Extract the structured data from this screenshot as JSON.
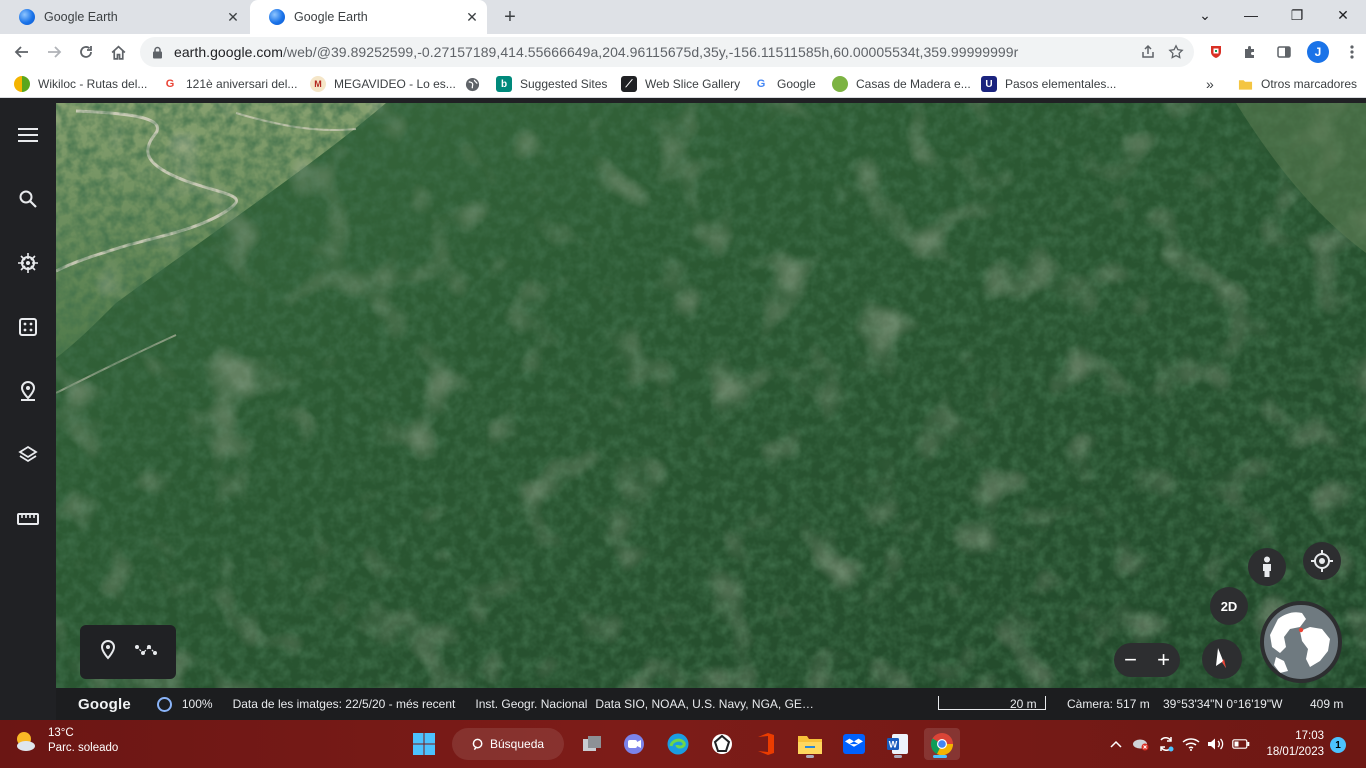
{
  "browser": {
    "tabs": [
      {
        "title": "Google Earth",
        "close": "✕"
      },
      {
        "title": "Google Earth",
        "close": "✕"
      }
    ],
    "new_tab": "+",
    "window_controls": {
      "minimize": "—",
      "maximize": "❐",
      "close": "✕",
      "tab_search": "⌄"
    },
    "url_host": "earth.google.com",
    "url_rest": "/web/@39.89252599,-0.27157189,414.55666649a,204.96115675d,35y,-156.11511585h,60.00005534t,359.99999999r",
    "profile_initial": "J",
    "bookmarks": [
      {
        "label": "Wikiloc - Rutas del...",
        "icon": "wikiloc-icon",
        "color": "#5aa61d"
      },
      {
        "label": "121è aniversari del...",
        "icon": "google-g-icon",
        "color": "#ea4335"
      },
      {
        "label": "MEGAVIDEO - Lo es...",
        "icon": "megavideo-icon",
        "color": "#d93025"
      },
      {
        "label": "",
        "icon": "globe-icon",
        "color": "#5f6368"
      },
      {
        "label": "Suggested Sites",
        "icon": "bing-icon",
        "color": "#00897b"
      },
      {
        "label": "Web Slice Gallery",
        "icon": "web-slice-icon",
        "color": "#202124"
      },
      {
        "label": "Google",
        "icon": "google-g-icon",
        "color": "#4285f4"
      },
      {
        "label": "Casas de Madera e...",
        "icon": "leaf-icon",
        "color": "#7cb342"
      },
      {
        "label": "Pasos elementales...",
        "icon": "u-logo-icon",
        "color": "#1a237e"
      }
    ],
    "bookmarks_overflow": "»",
    "other_bookmarks": "Otros marcadores"
  },
  "earth": {
    "status": {
      "logo": "Google",
      "load_percent": "100%",
      "imagery_date": "Data de les imatges: 22/5/20 - més recent",
      "attribution_1": "Inst. Geogr. Nacional",
      "attribution_2": "Data SIO, NOAA, U.S. Navy, NGA, GEB...",
      "scale": "20 m",
      "camera": "Càmera: 517 m",
      "coordinates": "39°53'34\"N 0°16'19\"W",
      "altitude": "409 m"
    },
    "view_mode_button": "2D",
    "zoom_out": "−",
    "zoom_in": "+"
  },
  "taskbar": {
    "weather_temp": "13°C",
    "weather_desc": "Parc. soleado",
    "search_label": "Búsqueda",
    "time": "17:03",
    "date": "18/01/2023",
    "notifications": "1"
  },
  "colors": {
    "sidebar": "#202124",
    "forest": "#264f2c",
    "accent": "#8ab4f8",
    "taskbar": "#7a1b17"
  }
}
